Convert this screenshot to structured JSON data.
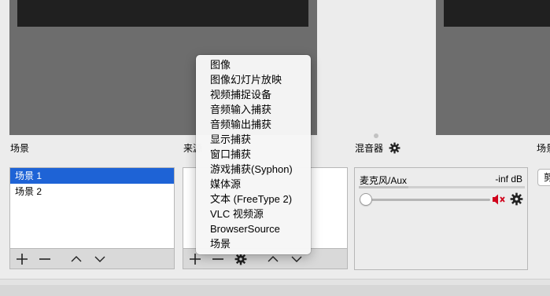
{
  "docks": {
    "scenes_title": "场景",
    "sources_title": "来源",
    "mixer_title": "混音器",
    "transitions_title": "场景"
  },
  "scenes": {
    "items": [
      {
        "label": "场景 1",
        "selected": true
      },
      {
        "label": "场景 2",
        "selected": false
      }
    ]
  },
  "mixer": {
    "channel_name": "麦克风/Aux",
    "level": "-inf dB",
    "muted": true
  },
  "right_dock": {
    "button_label": "剪"
  },
  "add_source_menu": {
    "items": [
      "图像",
      "图像幻灯片放映",
      "视频捕捉设备",
      "音频输入捕获",
      "音频输出捕获",
      "显示捕获",
      "窗口捕获",
      "游戏捕获(Syphon)",
      "媒体源",
      "文本 (FreeType 2)",
      "VLC 视频源",
      "BrowserSource",
      "场景"
    ]
  },
  "colors": {
    "selection": "#1e63d6",
    "mute_red": "#d0021b",
    "preview_gray": "#6d6d6d",
    "preview_black": "#202020"
  }
}
